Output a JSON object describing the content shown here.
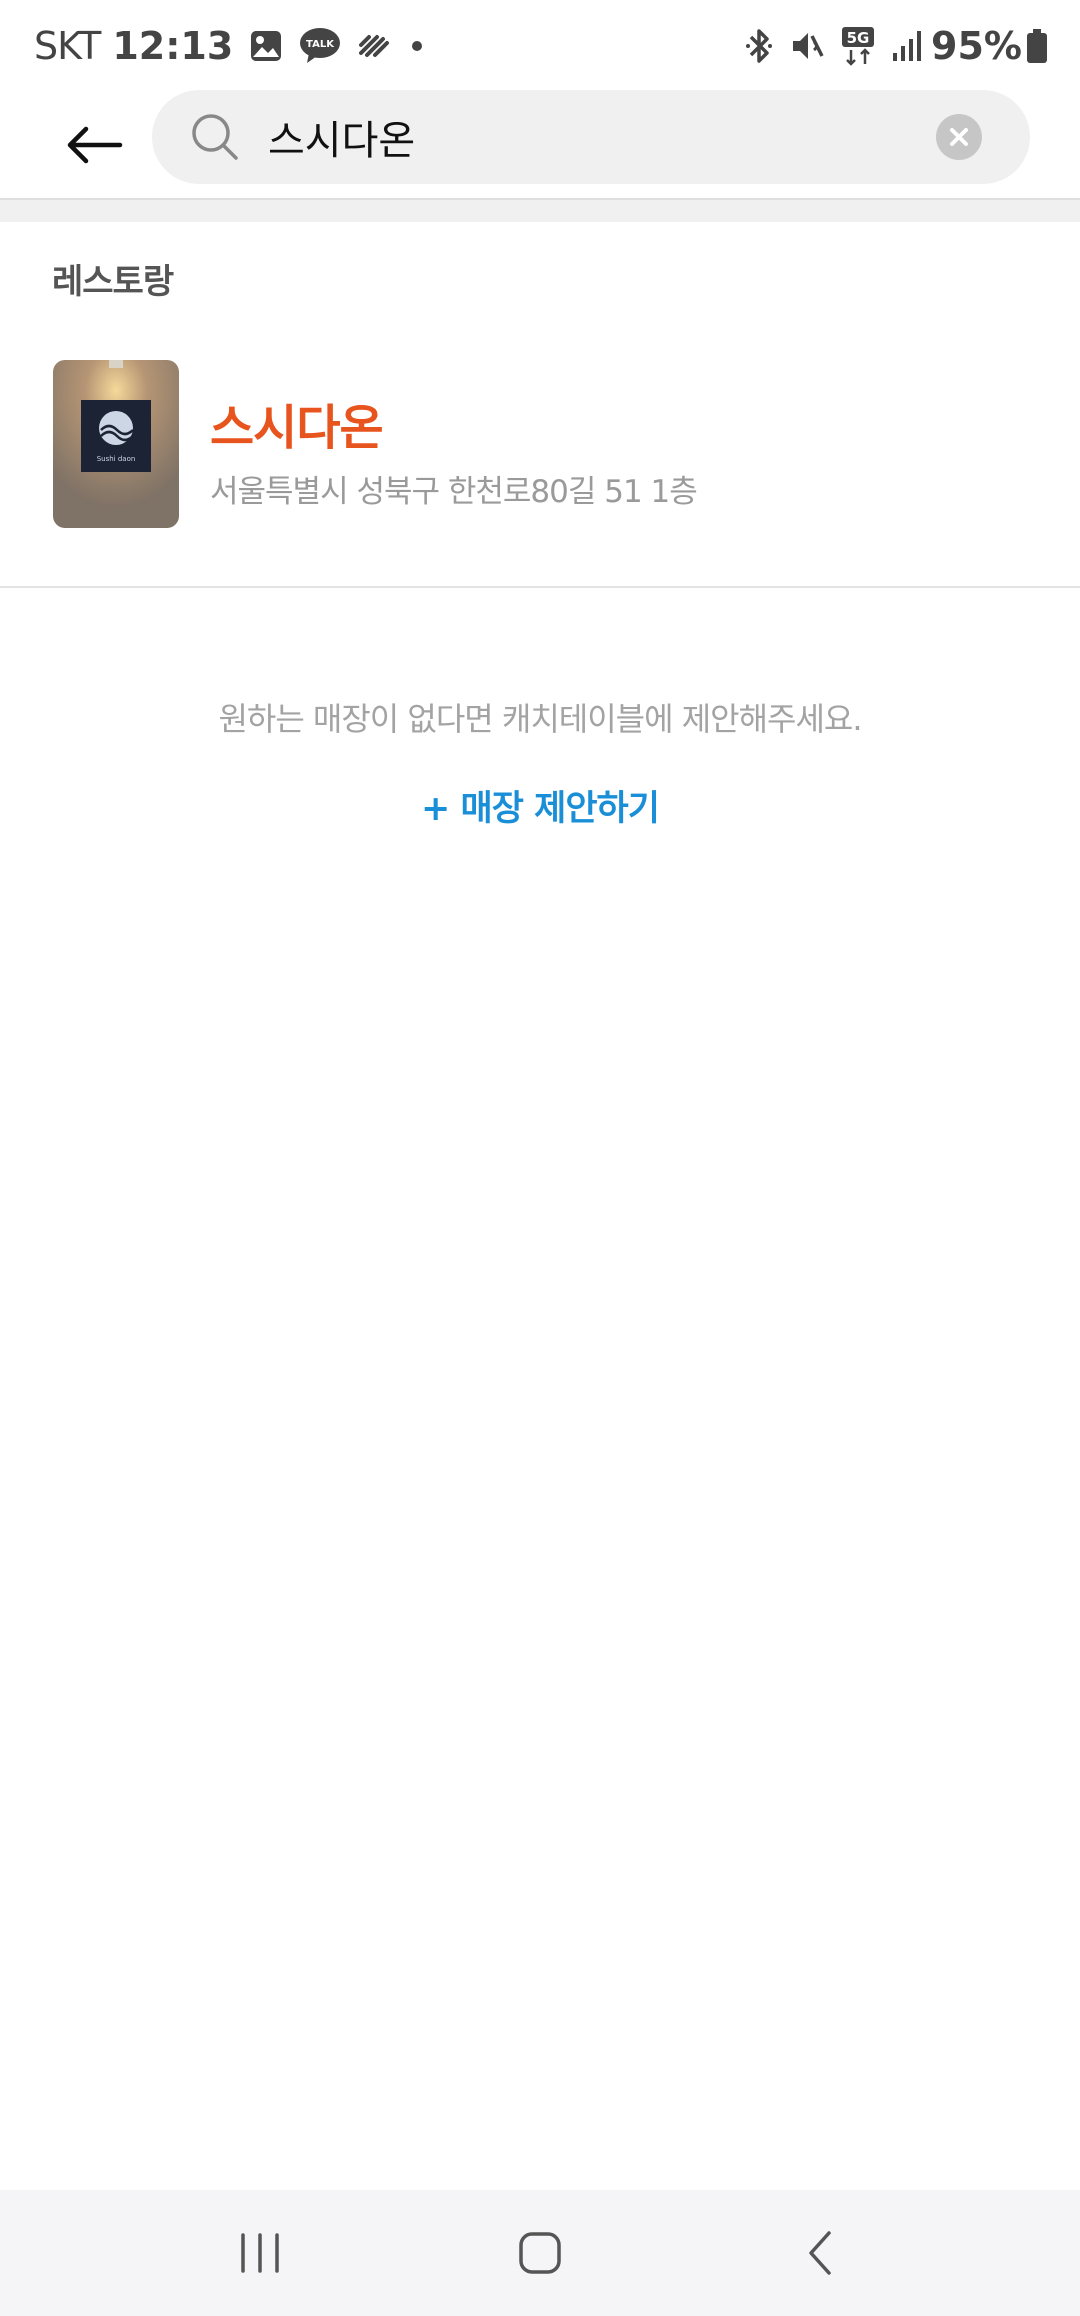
{
  "status_bar": {
    "carrier": "SKT",
    "time": "12:13",
    "talk_label": "TALK",
    "network_label": "5G",
    "battery": "95%"
  },
  "search": {
    "query": "스시다온",
    "placeholder": ""
  },
  "section": {
    "title": "레스토랑"
  },
  "results": [
    {
      "name": "스시다온",
      "address": "서울특별시 성북구 한천로80길 51 1층",
      "sign_text": "Sushi daon"
    }
  ],
  "empty_state": {
    "message": "원하는 매장이 없다면 캐치테이블에 제안해주세요.",
    "link_label": "+ 매장 제안하기"
  },
  "colors": {
    "accent_name": "#e8541e",
    "link": "#1a8fd8"
  },
  "icons": {
    "back": "arrow-left-icon",
    "search": "search-icon",
    "clear": "clear-icon",
    "nav_recent": "recent-apps-icon",
    "nav_home": "home-icon",
    "nav_back": "back-icon"
  }
}
